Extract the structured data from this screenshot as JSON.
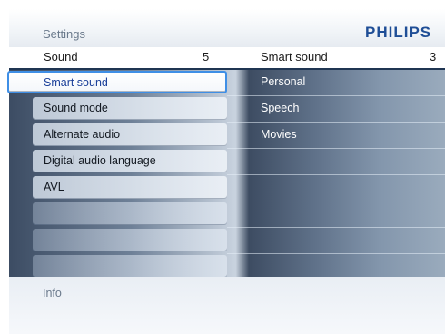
{
  "app": {
    "title": "Settings",
    "brand": "PHILIPS"
  },
  "left_header": {
    "label": "Sound",
    "count": "5"
  },
  "right_header": {
    "label": "Smart sound",
    "count": "3"
  },
  "left_items": [
    {
      "label": "Smart sound",
      "selected": true
    },
    {
      "label": "Sound mode"
    },
    {
      "label": "Alternate audio"
    },
    {
      "label": "Digital audio language"
    },
    {
      "label": "AVL"
    },
    {
      "label": ""
    },
    {
      "label": ""
    },
    {
      "label": ""
    }
  ],
  "right_items": [
    {
      "label": "Personal"
    },
    {
      "label": "Speech"
    },
    {
      "label": "Movies"
    },
    {
      "label": ""
    },
    {
      "label": ""
    },
    {
      "label": ""
    },
    {
      "label": ""
    },
    {
      "label": ""
    }
  ],
  "footer": {
    "info": "Info"
  },
  "colors": {
    "brand": "#1f4e96",
    "selection_border": "#3f8fe6",
    "selected_text": "#1a3f99"
  }
}
